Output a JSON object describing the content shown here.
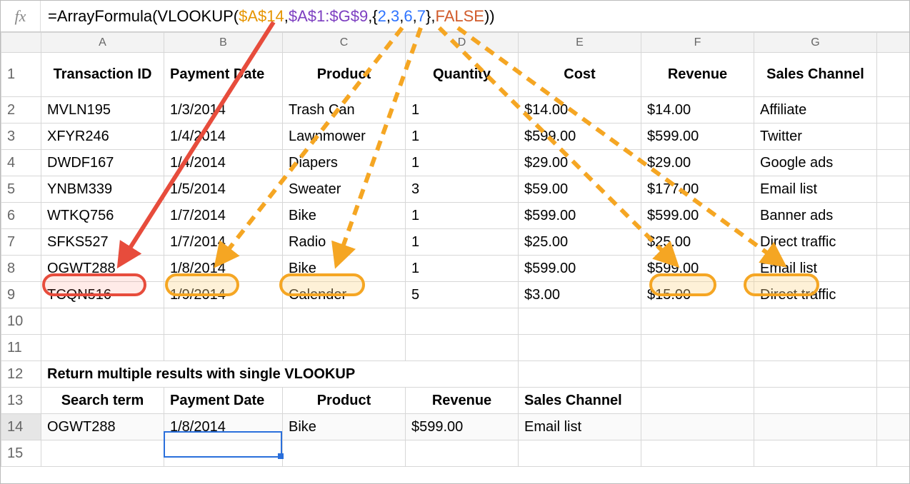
{
  "formula_bar": {
    "fx_label": "fx",
    "parts": {
      "pre": "=ArrayFormula(VLOOKUP(",
      "arg1": "$A$14",
      "comma1": ",",
      "arg2": "$A$1:$G$9",
      "comma2": ",{",
      "n1": "2",
      "c1": ",",
      "n2": "3",
      "c2": ",",
      "n3": "6",
      "c3": ",",
      "n4": "7",
      "close_br": "},",
      "arg_false": "FALSE",
      "tail": "))"
    }
  },
  "columns": [
    "A",
    "B",
    "C",
    "D",
    "E",
    "F",
    "G",
    ""
  ],
  "row_numbers": [
    "1",
    "2",
    "3",
    "4",
    "5",
    "6",
    "7",
    "8",
    "9",
    "10",
    "11",
    "12",
    "13",
    "14",
    "15"
  ],
  "headers": {
    "A": "Transaction ID",
    "B": "Payment Date",
    "C": "Product",
    "D": "Quantity",
    "E": "Cost",
    "F": "Revenue",
    "G": "Sales Channel"
  },
  "rows": [
    {
      "A": "MVLN195",
      "B": "1/3/2014",
      "C": "Trash Can",
      "D": "1",
      "E": "$14.00",
      "F": "$14.00",
      "G": "Affiliate"
    },
    {
      "A": "XFYR246",
      "B": "1/4/2014",
      "C": "Lawnmower",
      "D": "1",
      "E": "$599.00",
      "F": "$599.00",
      "G": "Twitter"
    },
    {
      "A": "DWDF167",
      "B": "1/4/2014",
      "C": "Diapers",
      "D": "1",
      "E": "$29.00",
      "F": "$29.00",
      "G": "Google ads"
    },
    {
      "A": "YNBM339",
      "B": "1/5/2014",
      "C": "Sweater",
      "D": "3",
      "E": "$59.00",
      "F": "$177.00",
      "G": "Email list"
    },
    {
      "A": "WTKQ756",
      "B": "1/7/2014",
      "C": "Bike",
      "D": "1",
      "E": "$599.00",
      "F": "$599.00",
      "G": "Banner ads"
    },
    {
      "A": "SFKS527",
      "B": "1/7/2014",
      "C": "Radio",
      "D": "1",
      "E": "$25.00",
      "F": "$25.00",
      "G": "Direct traffic"
    },
    {
      "A": "OGWT288",
      "B": "1/8/2014",
      "C": "Bike",
      "D": "1",
      "E": "$599.00",
      "F": "$599.00",
      "G": "Email list"
    },
    {
      "A": "TCQN516",
      "B": "1/9/2014",
      "C": "Calender",
      "D": "5",
      "E": "$3.00",
      "F": "$15.00",
      "G": "Direct traffic"
    }
  ],
  "section_title": "Return multiple results with single VLOOKUP",
  "search_headers": {
    "A": "Search term",
    "B": "Payment Date",
    "C": "Product",
    "D": "Revenue",
    "E": "Sales Channel"
  },
  "search_row": {
    "A": "OGWT288",
    "B": "1/8/2014",
    "C": "Bike",
    "D": "$599.00",
    "E": "Email list"
  },
  "annotations": {
    "solid_arrow": "red solid arrow from formula $A$14 to cell A8",
    "dashed_arrows": "orange dashed arrows from {2,3,6,7} to columns B,C,F,G row 8",
    "highlight_red": "A8",
    "highlight_orange": [
      "B8",
      "C8",
      "F8",
      "G8"
    ]
  }
}
